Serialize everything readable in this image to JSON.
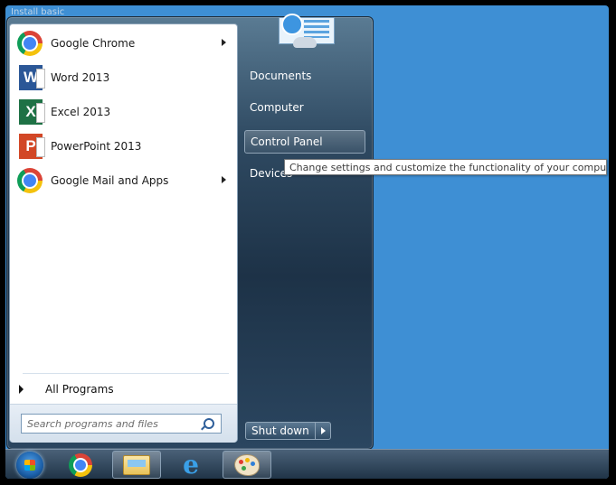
{
  "desktop": {
    "top_text": "Install basic"
  },
  "start_menu": {
    "programs": [
      {
        "label": "Google Chrome",
        "icon": "chrome-icon",
        "has_submenu": true
      },
      {
        "label": "Word 2013",
        "icon": "word-icon",
        "letter": "W",
        "has_submenu": false
      },
      {
        "label": "Excel 2013",
        "icon": "excel-icon",
        "letter": "X",
        "has_submenu": false
      },
      {
        "label": "PowerPoint 2013",
        "icon": "powerpoint-icon",
        "letter": "P",
        "has_submenu": false
      },
      {
        "label": "Google Mail and Apps",
        "icon": "chrome-icon",
        "has_submenu": true
      }
    ],
    "all_programs_label": "All Programs",
    "search": {
      "placeholder": "Search programs and files",
      "value": ""
    },
    "right_links": [
      {
        "label": "Documents",
        "highlighted": false
      },
      {
        "label": "Computer",
        "highlighted": false
      },
      {
        "label": "Control Panel",
        "highlighted": true
      },
      {
        "label": "Devices",
        "highlighted": false
      }
    ],
    "user_icon": "control-panel-icon",
    "shutdown_label": "Shut down"
  },
  "tooltip": {
    "text": "Change settings and customize the functionality of your computer."
  },
  "taskbar": {
    "items": [
      {
        "name": "start-orb",
        "icon": "windows-orb-icon"
      },
      {
        "name": "chrome",
        "icon": "chrome-icon"
      },
      {
        "name": "explorer",
        "icon": "folder-icon"
      },
      {
        "name": "internet-explorer",
        "icon": "ie-icon"
      },
      {
        "name": "paint",
        "icon": "paint-icon"
      }
    ]
  },
  "colors": {
    "desktop_bg": "#3e8fd4",
    "menu_dark": "#1d3247",
    "tooltip_bg": "#ffffff"
  }
}
